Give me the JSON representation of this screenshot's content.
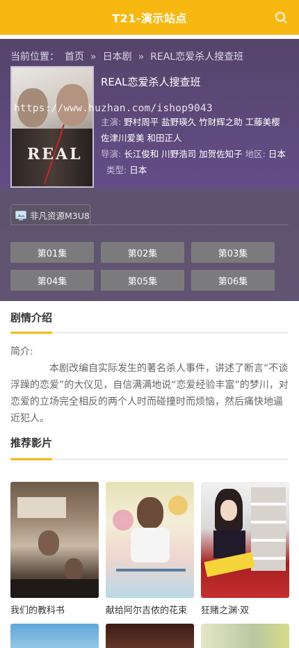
{
  "header": {
    "title": "T21-演示站点",
    "search_icon": "search-icon",
    "bg_color": "#f7b812"
  },
  "breadcrumb": {
    "prefix": "当前位置：",
    "items": [
      "首页",
      "日本剧",
      "REAL恋爱杀人搜查班"
    ],
    "separator": "»"
  },
  "movie": {
    "title": "REAL恋爱杀人搜查班",
    "poster_logo": "REAL",
    "actors_label": "主演:",
    "actors": "野村周平 盐野瑛久 竹财辉之助 工藤美樱 佐津川爱美 和田正人",
    "director_label": "导演:",
    "director": "长江俊和 川野浩司 加贺佐知子",
    "region_label": "地区:",
    "region": "日本",
    "type_label": "类型:",
    "type": "日本"
  },
  "watermark": "https://www.huzhan.com/ishop9043",
  "player": {
    "source_tab": "非凡资源M3U8",
    "episodes": [
      "第01集",
      "第02集",
      "第03集",
      "第04集",
      "第05集",
      "第06集"
    ]
  },
  "synopsis": {
    "heading": "剧情介绍",
    "label": "简介:",
    "text": "本剧改编自实际发生的著名杀人事件，讲述了断言“不谈浮躁的恋爱”的大仪见，自信满满地说“恋爱经验丰富”的梦川，对恋爱的立场完全相反的两个人时而碰撞时而烦恼，然后痛快地逼近犯人。"
  },
  "recommended": {
    "heading": "推荐影片",
    "items": [
      {
        "name": "我们的教科书"
      },
      {
        "name": "献给阿尔吉侬的花束"
      },
      {
        "name": "狂赌之渊·双"
      }
    ]
  },
  "colors": {
    "accent": "#f7b812",
    "hero_bg": "#634c86",
    "episode_button": "#7b7b7d"
  }
}
